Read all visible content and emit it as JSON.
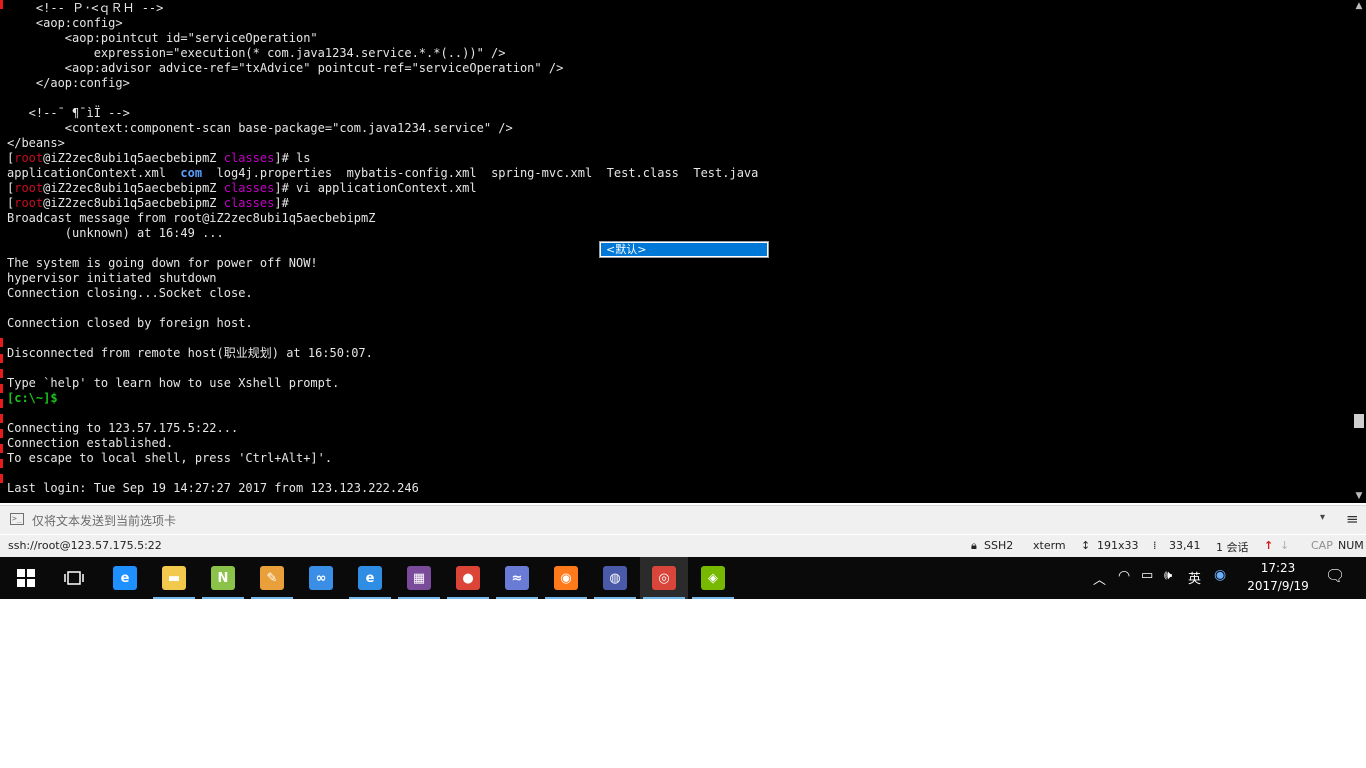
{
  "terminal": {
    "lines": [
      [
        {
          "t": "    <!-- Ｐ·<ｑＲＨ -->"
        }
      ],
      [
        {
          "t": "    <aop:config>"
        }
      ],
      [
        {
          "t": "        <aop:pointcut id=\"serviceOperation\""
        }
      ],
      [
        {
          "t": "            expression=\"execution(* com.java1234.service.*.*(..))\" />"
        }
      ],
      [
        {
          "t": "        <aop:advisor advice-ref=\"txAdvice\" pointcut-ref=\"serviceOperation\" />"
        }
      ],
      [
        {
          "t": "    </aop:config>"
        }
      ],
      [
        {
          "t": ""
        }
      ],
      [
        {
          "t": "   <!--¯ ¶¯ìÏ -->"
        }
      ],
      [
        {
          "t": "        <context:component-scan base-package=\"com.java1234.service\" />"
        }
      ],
      [
        {
          "t": "</beans>"
        }
      ],
      [
        {
          "t": "["
        },
        {
          "t": "root",
          "c": "red"
        },
        {
          "t": "@iZ2zec8ubi1q5aecbebipmZ "
        },
        {
          "t": "classes",
          "c": "mag"
        },
        {
          "t": "]# ls"
        }
      ],
      [
        {
          "t": "applicationContext.xml  "
        },
        {
          "t": "com",
          "c": "blue"
        },
        {
          "t": "  log4j.properties  mybatis-config.xml  spring-mvc.xml  Test.class  Test.java"
        }
      ],
      [
        {
          "t": "["
        },
        {
          "t": "root",
          "c": "red"
        },
        {
          "t": "@iZ2zec8ubi1q5aecbebipmZ "
        },
        {
          "t": "classes",
          "c": "mag"
        },
        {
          "t": "]# vi applicationContext.xml"
        }
      ],
      [
        {
          "t": "["
        },
        {
          "t": "root",
          "c": "red"
        },
        {
          "t": "@iZ2zec8ubi1q5aecbebipmZ "
        },
        {
          "t": "classes",
          "c": "mag"
        },
        {
          "t": "]#"
        }
      ],
      [
        {
          "t": "Broadcast message from root@iZ2zec8ubi1q5aecbebipmZ"
        }
      ],
      [
        {
          "t": "        (unknown) at 16:49 ..."
        }
      ],
      [
        {
          "t": ""
        }
      ],
      [
        {
          "t": "The system is going down for power off NOW!"
        }
      ],
      [
        {
          "t": "hypervisor initiated shutdown"
        }
      ],
      [
        {
          "t": "Connection closing...Socket close."
        }
      ],
      [
        {
          "t": ""
        }
      ],
      [
        {
          "t": "Connection closed by foreign host."
        }
      ],
      [
        {
          "t": ""
        }
      ],
      [
        {
          "t": "Disconnected from remote host(职业规划) at 16:50:07."
        }
      ],
      [
        {
          "t": ""
        }
      ],
      [
        {
          "t": "Type `help' to learn how to use Xshell prompt."
        }
      ],
      [
        {
          "t": "[c:\\~]$",
          "c": "green"
        }
      ],
      [
        {
          "t": ""
        }
      ],
      [
        {
          "t": "Connecting to 123.57.175.5:22..."
        }
      ],
      [
        {
          "t": "Connection established."
        }
      ],
      [
        {
          "t": "To escape to local shell, press 'Ctrl+Alt+]'."
        }
      ],
      [
        {
          "t": ""
        }
      ],
      [
        {
          "t": "Last login: Tue Sep 19 14:27:27 2017 from 123.123.222.246"
        }
      ]
    ]
  },
  "popup": {
    "item": "<默认>"
  },
  "scrollbar": {
    "up_icon": "chevron-up-icon",
    "down_icon": "chevron-down-icon",
    "up_glyph": "▲",
    "down_glyph": "▼"
  },
  "sendbar": {
    "placeholder": "仅将文本发送到当前选项卡",
    "dropdown_glyph": "▾",
    "menu_glyph": "≡",
    "icon_glyph": ">_"
  },
  "statusbar": {
    "address": "ssh://root@123.57.175.5:22",
    "protocol": "SSH2",
    "term_type": "xterm",
    "size": "191x33",
    "cursor": "33,41",
    "sessions": "1 会话",
    "cap": "CAP",
    "num": "NUM"
  },
  "taskbar": {
    "apps": [
      {
        "name": "edge",
        "glyph": "e",
        "color": "#1e90ff"
      },
      {
        "name": "file-explorer",
        "glyph": "▬",
        "color": "#f2c94c"
      },
      {
        "name": "notepad-plus",
        "glyph": "N",
        "color": "#8bc34a"
      },
      {
        "name": "paint",
        "glyph": "✎",
        "color": "#e9a03b"
      },
      {
        "name": "baidu-netdisk",
        "glyph": "∞",
        "color": "#3a8ee6"
      },
      {
        "name": "internet-explorer",
        "glyph": "e",
        "color": "#2f8de4"
      },
      {
        "name": "game-launcher",
        "glyph": "▦",
        "color": "#7a4b9a"
      },
      {
        "name": "chrome",
        "glyph": "●",
        "color": "#db4437"
      },
      {
        "name": "dolphin-app",
        "glyph": "≈",
        "color": "#6a7bd6"
      },
      {
        "name": "firefox",
        "glyph": "◉",
        "color": "#ff7a1a"
      },
      {
        "name": "network-app",
        "glyph": "◍",
        "color": "#4b5aa8"
      },
      {
        "name": "xshell",
        "glyph": "◎",
        "color": "#d9453a"
      },
      {
        "name": "nvidia-app",
        "glyph": "◈",
        "color": "#76b900"
      }
    ],
    "tray": {
      "caret": "︿",
      "ime": "英",
      "time": "17:23",
      "date": "2017/9/19"
    }
  }
}
